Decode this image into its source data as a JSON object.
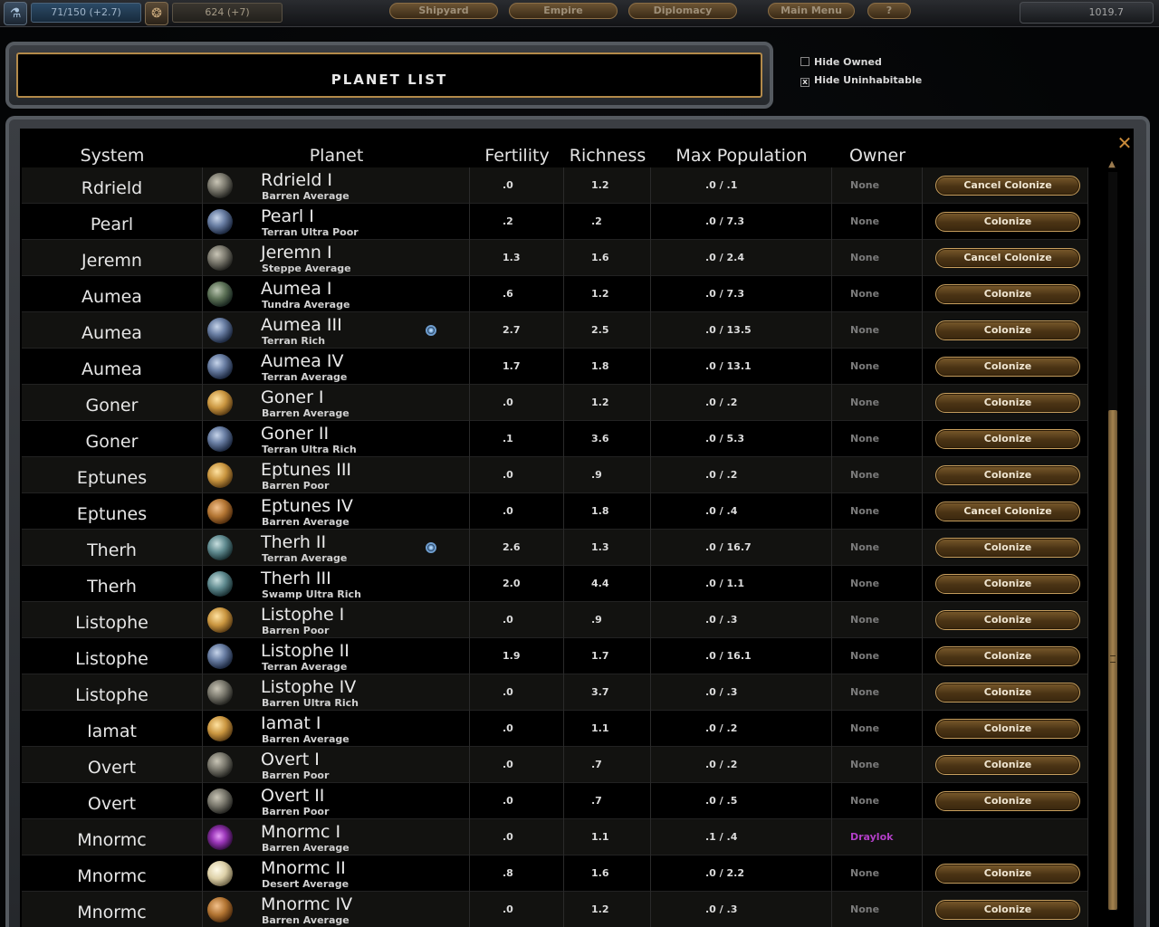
{
  "topbar": {
    "research": "71/150 (+2.7)",
    "credits": "624 (+7)",
    "nav": [
      "Shipyard",
      "Empire",
      "Diplomacy",
      "Main Menu",
      "?"
    ],
    "stardate": "1019.7"
  },
  "title": "PLANET LIST",
  "filters": {
    "hide_owned": {
      "label": "Hide Owned",
      "checked": false
    },
    "hide_uninhabitable": {
      "label": "Hide Uninhabitable",
      "checked": true,
      "mark": "x"
    }
  },
  "columns": [
    "System",
    "Planet",
    "Fertility",
    "Richness",
    "Max Population",
    "Owner"
  ],
  "rows": [
    {
      "system": "Rdrield",
      "planet": "Rdrield I",
      "class": "Barren Average",
      "fertility": ".0",
      "richness": "1.2",
      "pop": ".0 / .1",
      "owner": "None",
      "action": "Cancel Colonize",
      "globe": "gray"
    },
    {
      "system": "Pearl",
      "planet": "Pearl I",
      "class": "Terran Ultra Poor",
      "fertility": ".2",
      "richness": ".2",
      "pop": ".0 / 7.3",
      "owner": "None",
      "action": "Colonize",
      "globe": "blue"
    },
    {
      "system": "Jeremn",
      "planet": "Jeremn I",
      "class": "Steppe Average",
      "fertility": "1.3",
      "richness": "1.6",
      "pop": ".0 / 2.4",
      "owner": "None",
      "action": "Cancel Colonize",
      "globe": "gray"
    },
    {
      "system": "Aumea",
      "planet": "Aumea I",
      "class": "Tundra Average",
      "fertility": ".6",
      "richness": "1.2",
      "pop": ".0 / 7.3",
      "owner": "None",
      "action": "Colonize",
      "globe": "green"
    },
    {
      "system": "Aumea",
      "planet": "Aumea III",
      "class": "Terran Rich",
      "fertility": "2.7",
      "richness": "2.5",
      "pop": ".0 / 13.5",
      "owner": "None",
      "action": "Colonize",
      "globe": "blue",
      "marker": true
    },
    {
      "system": "Aumea",
      "planet": "Aumea IV",
      "class": "Terran Average",
      "fertility": "1.7",
      "richness": "1.8",
      "pop": ".0 / 13.1",
      "owner": "None",
      "action": "Colonize",
      "globe": "blue"
    },
    {
      "system": "Goner",
      "planet": "Goner I",
      "class": "Barren Average",
      "fertility": ".0",
      "richness": "1.2",
      "pop": ".0 / .2",
      "owner": "None",
      "action": "Colonize",
      "globe": "gold"
    },
    {
      "system": "Goner",
      "planet": "Goner II",
      "class": "Terran Ultra Rich",
      "fertility": ".1",
      "richness": "3.6",
      "pop": ".0 / 5.3",
      "owner": "None",
      "action": "Colonize",
      "globe": "blue"
    },
    {
      "system": "Eptunes",
      "planet": "Eptunes III",
      "class": "Barren Poor",
      "fertility": ".0",
      "richness": ".9",
      "pop": ".0 / .2",
      "owner": "None",
      "action": "Colonize",
      "globe": "gold"
    },
    {
      "system": "Eptunes",
      "planet": "Eptunes IV",
      "class": "Barren Average",
      "fertility": ".0",
      "richness": "1.8",
      "pop": ".0 / .4",
      "owner": "None",
      "action": "Cancel Colonize",
      "globe": "orange"
    },
    {
      "system": "Therh",
      "planet": "Therh II",
      "class": "Terran Average",
      "fertility": "2.6",
      "richness": "1.3",
      "pop": ".0 / 16.7",
      "owner": "None",
      "action": "Colonize",
      "globe": "teal",
      "marker": true
    },
    {
      "system": "Therh",
      "planet": "Therh III",
      "class": "Swamp Ultra Rich",
      "fertility": "2.0",
      "richness": "4.4",
      "pop": ".0 / 1.1",
      "owner": "None",
      "action": "Colonize",
      "globe": "teal"
    },
    {
      "system": "Listophe",
      "planet": "Listophe I",
      "class": "Barren Poor",
      "fertility": ".0",
      "richness": ".9",
      "pop": ".0 / .3",
      "owner": "None",
      "action": "Colonize",
      "globe": "gold"
    },
    {
      "system": "Listophe",
      "planet": "Listophe II",
      "class": "Terran Average",
      "fertility": "1.9",
      "richness": "1.7",
      "pop": ".0 / 16.1",
      "owner": "None",
      "action": "Colonize",
      "globe": "blue"
    },
    {
      "system": "Listophe",
      "planet": "Listophe IV",
      "class": "Barren Ultra Rich",
      "fertility": ".0",
      "richness": "3.7",
      "pop": ".0 / .3",
      "owner": "None",
      "action": "Colonize",
      "globe": "gray"
    },
    {
      "system": "Iamat",
      "planet": "Iamat I",
      "class": "Barren Average",
      "fertility": ".0",
      "richness": "1.1",
      "pop": ".0 / .2",
      "owner": "None",
      "action": "Colonize",
      "globe": "gold"
    },
    {
      "system": "Overt",
      "planet": "Overt I",
      "class": "Barren Poor",
      "fertility": ".0",
      "richness": ".7",
      "pop": ".0 / .2",
      "owner": "None",
      "action": "Colonize",
      "globe": "gray"
    },
    {
      "system": "Overt",
      "planet": "Overt II",
      "class": "Barren Poor",
      "fertility": ".0",
      "richness": ".7",
      "pop": ".0 / .5",
      "owner": "None",
      "action": "Colonize",
      "globe": "gray"
    },
    {
      "system": "Mnormc",
      "planet": "Mnormc I",
      "class": "Barren Average",
      "fertility": ".0",
      "richness": "1.1",
      "pop": ".1 / .4",
      "owner": "Draylok",
      "action": "",
      "globe": "purple"
    },
    {
      "system": "Mnormc",
      "planet": "Mnormc II",
      "class": "Desert Average",
      "fertility": ".8",
      "richness": "1.6",
      "pop": ".0 / 2.2",
      "owner": "None",
      "action": "Colonize",
      "globe": "cream"
    },
    {
      "system": "Mnormc",
      "planet": "Mnormc IV",
      "class": "Barren Average",
      "fertility": ".0",
      "richness": "1.2",
      "pop": ".0 / .3",
      "owner": "None",
      "action": "Colonize",
      "globe": "orange"
    }
  ],
  "icons": {
    "research": "research-icon",
    "credits": "credits-icon",
    "close": "close-icon",
    "scroll_up": "scroll-up-icon",
    "marker": "blue-marker-icon"
  },
  "colors": {
    "accent_gold": "#c9a05f",
    "owner_draylok": "#b23fc7",
    "owner_none": "#7b7b7b"
  }
}
